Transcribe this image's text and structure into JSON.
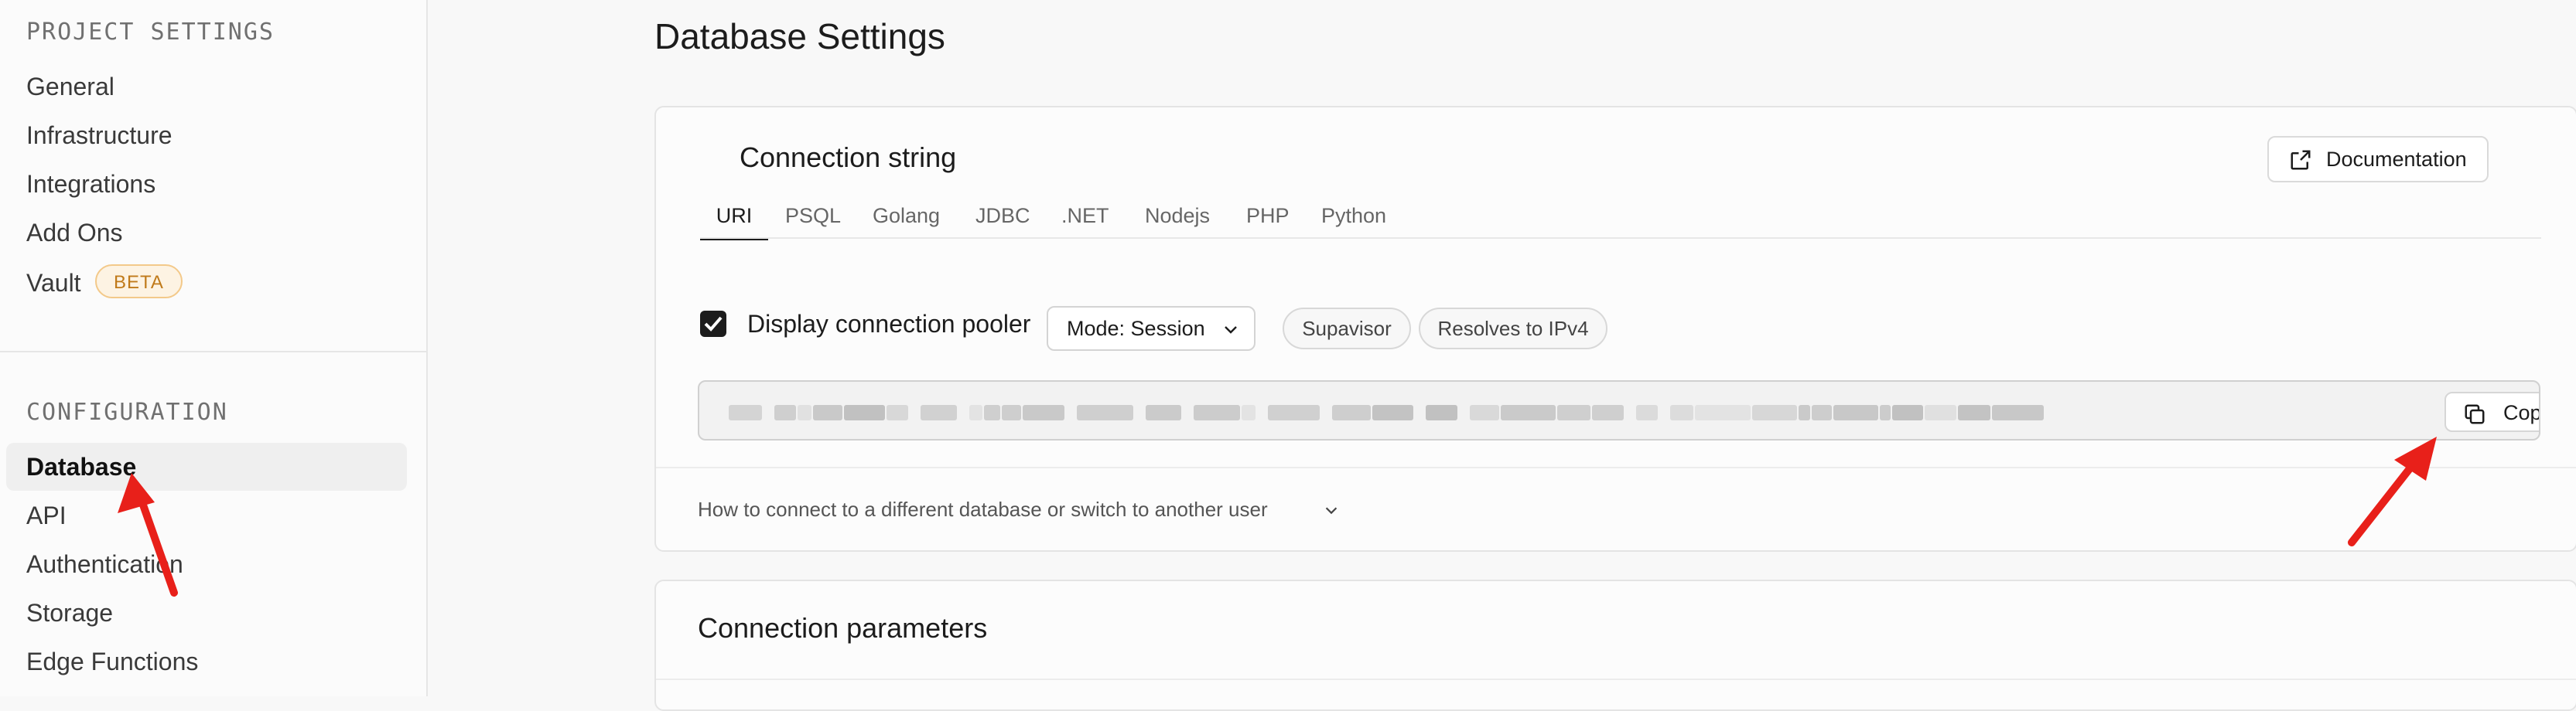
{
  "sidebar": {
    "project_settings_title": "PROJECT SETTINGS",
    "project_items": [
      "General",
      "Infrastructure",
      "Integrations",
      "Add Ons",
      "Vault"
    ],
    "vault_badge": "BETA",
    "configuration_title": "CONFIGURATION",
    "config_items": [
      "Database",
      "API",
      "Authentication",
      "Storage",
      "Edge Functions"
    ],
    "active_item": "Database"
  },
  "main": {
    "page_title": "Database Settings",
    "connection": {
      "title": "Connection string",
      "documentation_label": "Documentation",
      "tabs": [
        "URI",
        "PSQL",
        "Golang",
        "JDBC",
        ".NET",
        "Nodejs",
        "PHP",
        "Python"
      ],
      "active_tab": "URI",
      "pooler_label": "Display connection pooler",
      "pooler_checked": true,
      "mode_label": "Mode: Session",
      "pills": [
        "Supavisor",
        "Resolves to IPv4"
      ],
      "copy_label": "Copy",
      "help_text": "How to connect to a different database or switch to another user"
    },
    "parameters": {
      "title": "Connection parameters"
    }
  },
  "colors": {
    "accent_dark": "#1c1c1c",
    "beta_text": "#c07a1a",
    "beta_bg": "#fdf3e3",
    "annotation_arrow": "#e8201a"
  },
  "icons": [
    "external-link-icon",
    "check-icon",
    "chevron-down-icon",
    "copy-icon"
  ]
}
